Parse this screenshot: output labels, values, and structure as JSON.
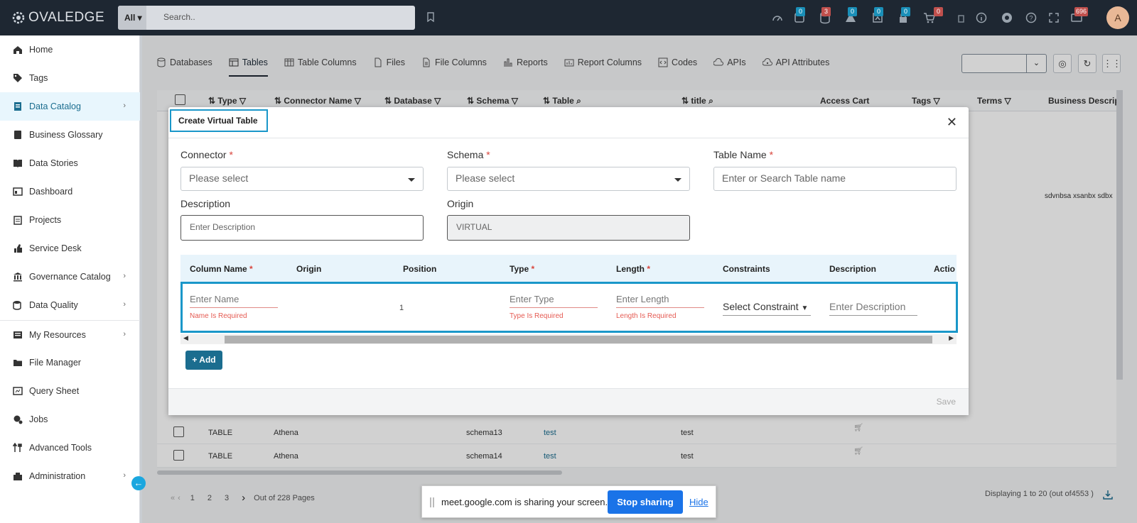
{
  "topbar": {
    "logo": "OVALEDGE",
    "search_scope": "All",
    "search_placeholder": "Search..",
    "badges": [
      "0",
      "3",
      "0",
      "0",
      "0",
      "0",
      "696"
    ],
    "avatar": "A"
  },
  "sidebar": {
    "items": [
      {
        "label": "Home",
        "icon": "home-icon"
      },
      {
        "label": "Tags",
        "icon": "tag-icon"
      },
      {
        "label": "Data Catalog",
        "icon": "data-catalog-icon"
      },
      {
        "label": "Business Glossary",
        "icon": "book-icon"
      },
      {
        "label": "Data Stories",
        "icon": "open-book-icon"
      },
      {
        "label": "Dashboard",
        "icon": "dashboard-icon"
      },
      {
        "label": "Projects",
        "icon": "projects-icon"
      },
      {
        "label": "Service Desk",
        "icon": "service-desk-icon"
      },
      {
        "label": "Governance Catalog",
        "icon": "governance-icon"
      },
      {
        "label": "Data Quality",
        "icon": "data-quality-icon"
      },
      {
        "label": "My Resources",
        "icon": "resources-icon"
      },
      {
        "label": "File Manager",
        "icon": "folder-icon"
      },
      {
        "label": "Query Sheet",
        "icon": "query-sheet-icon"
      },
      {
        "label": "Jobs",
        "icon": "jobs-icon"
      },
      {
        "label": "Advanced Tools",
        "icon": "tools-icon"
      },
      {
        "label": "Administration",
        "icon": "admin-icon"
      }
    ]
  },
  "tabs": [
    "Databases",
    "Tables",
    "Table Columns",
    "Files",
    "File Columns",
    "Reports",
    "Report Columns",
    "Codes",
    "APIs",
    "API Attributes"
  ],
  "grid": {
    "headers": [
      "Type",
      "Connector Name",
      "Database",
      "Schema",
      "Table",
      "title",
      "Access Cart",
      "Tags",
      "Terms",
      "Business Descripti"
    ],
    "right_text": "sdvnbsa xsanbx sdbx",
    "rows": [
      {
        "type": "TABLE",
        "connector": "Athena",
        "schema": "schema13",
        "table": "test",
        "title": "test"
      },
      {
        "type": "TABLE",
        "connector": "Athena",
        "schema": "schema14",
        "table": "test",
        "title": "test"
      }
    ]
  },
  "pager": {
    "pages": [
      "1",
      "2",
      "3"
    ],
    "out_of": "Out of 228 Pages",
    "displaying": "Displaying 1 to 20",
    "total": "(out of4553 )"
  },
  "modal": {
    "title": "Create Virtual Table",
    "connector_label": "Connector",
    "connector_placeholder": "Please select",
    "schema_label": "Schema",
    "schema_placeholder": "Please select",
    "tablename_label": "Table Name",
    "tablename_placeholder": "Enter or Search Table name",
    "description_label": "Description",
    "description_placeholder": "Enter Description",
    "origin_label": "Origin",
    "origin_value": "VIRTUAL",
    "columns": [
      "Column Name",
      "Origin",
      "Position",
      "Type",
      "Length",
      "Constraints",
      "Description",
      "Actio"
    ],
    "row": {
      "name_placeholder": "Enter Name",
      "name_error": "Name Is Required",
      "position": "1",
      "type_placeholder": "Enter Type",
      "type_error": "Type Is Required",
      "length_placeholder": "Enter Length",
      "length_error": "Length Is Required",
      "constraint_placeholder": "Select Constraint",
      "description_placeholder": "Enter Description"
    },
    "add_label": "Add",
    "save_label": "Save"
  },
  "share_bar": {
    "message": "meet.google.com is sharing your screen.",
    "stop_label": "Stop sharing",
    "hide_label": "Hide"
  },
  "colors": {
    "topbar": "#1e2732",
    "accent": "#1a97c9",
    "primary_button": "#1b6d8f",
    "error": "#e55a52"
  }
}
